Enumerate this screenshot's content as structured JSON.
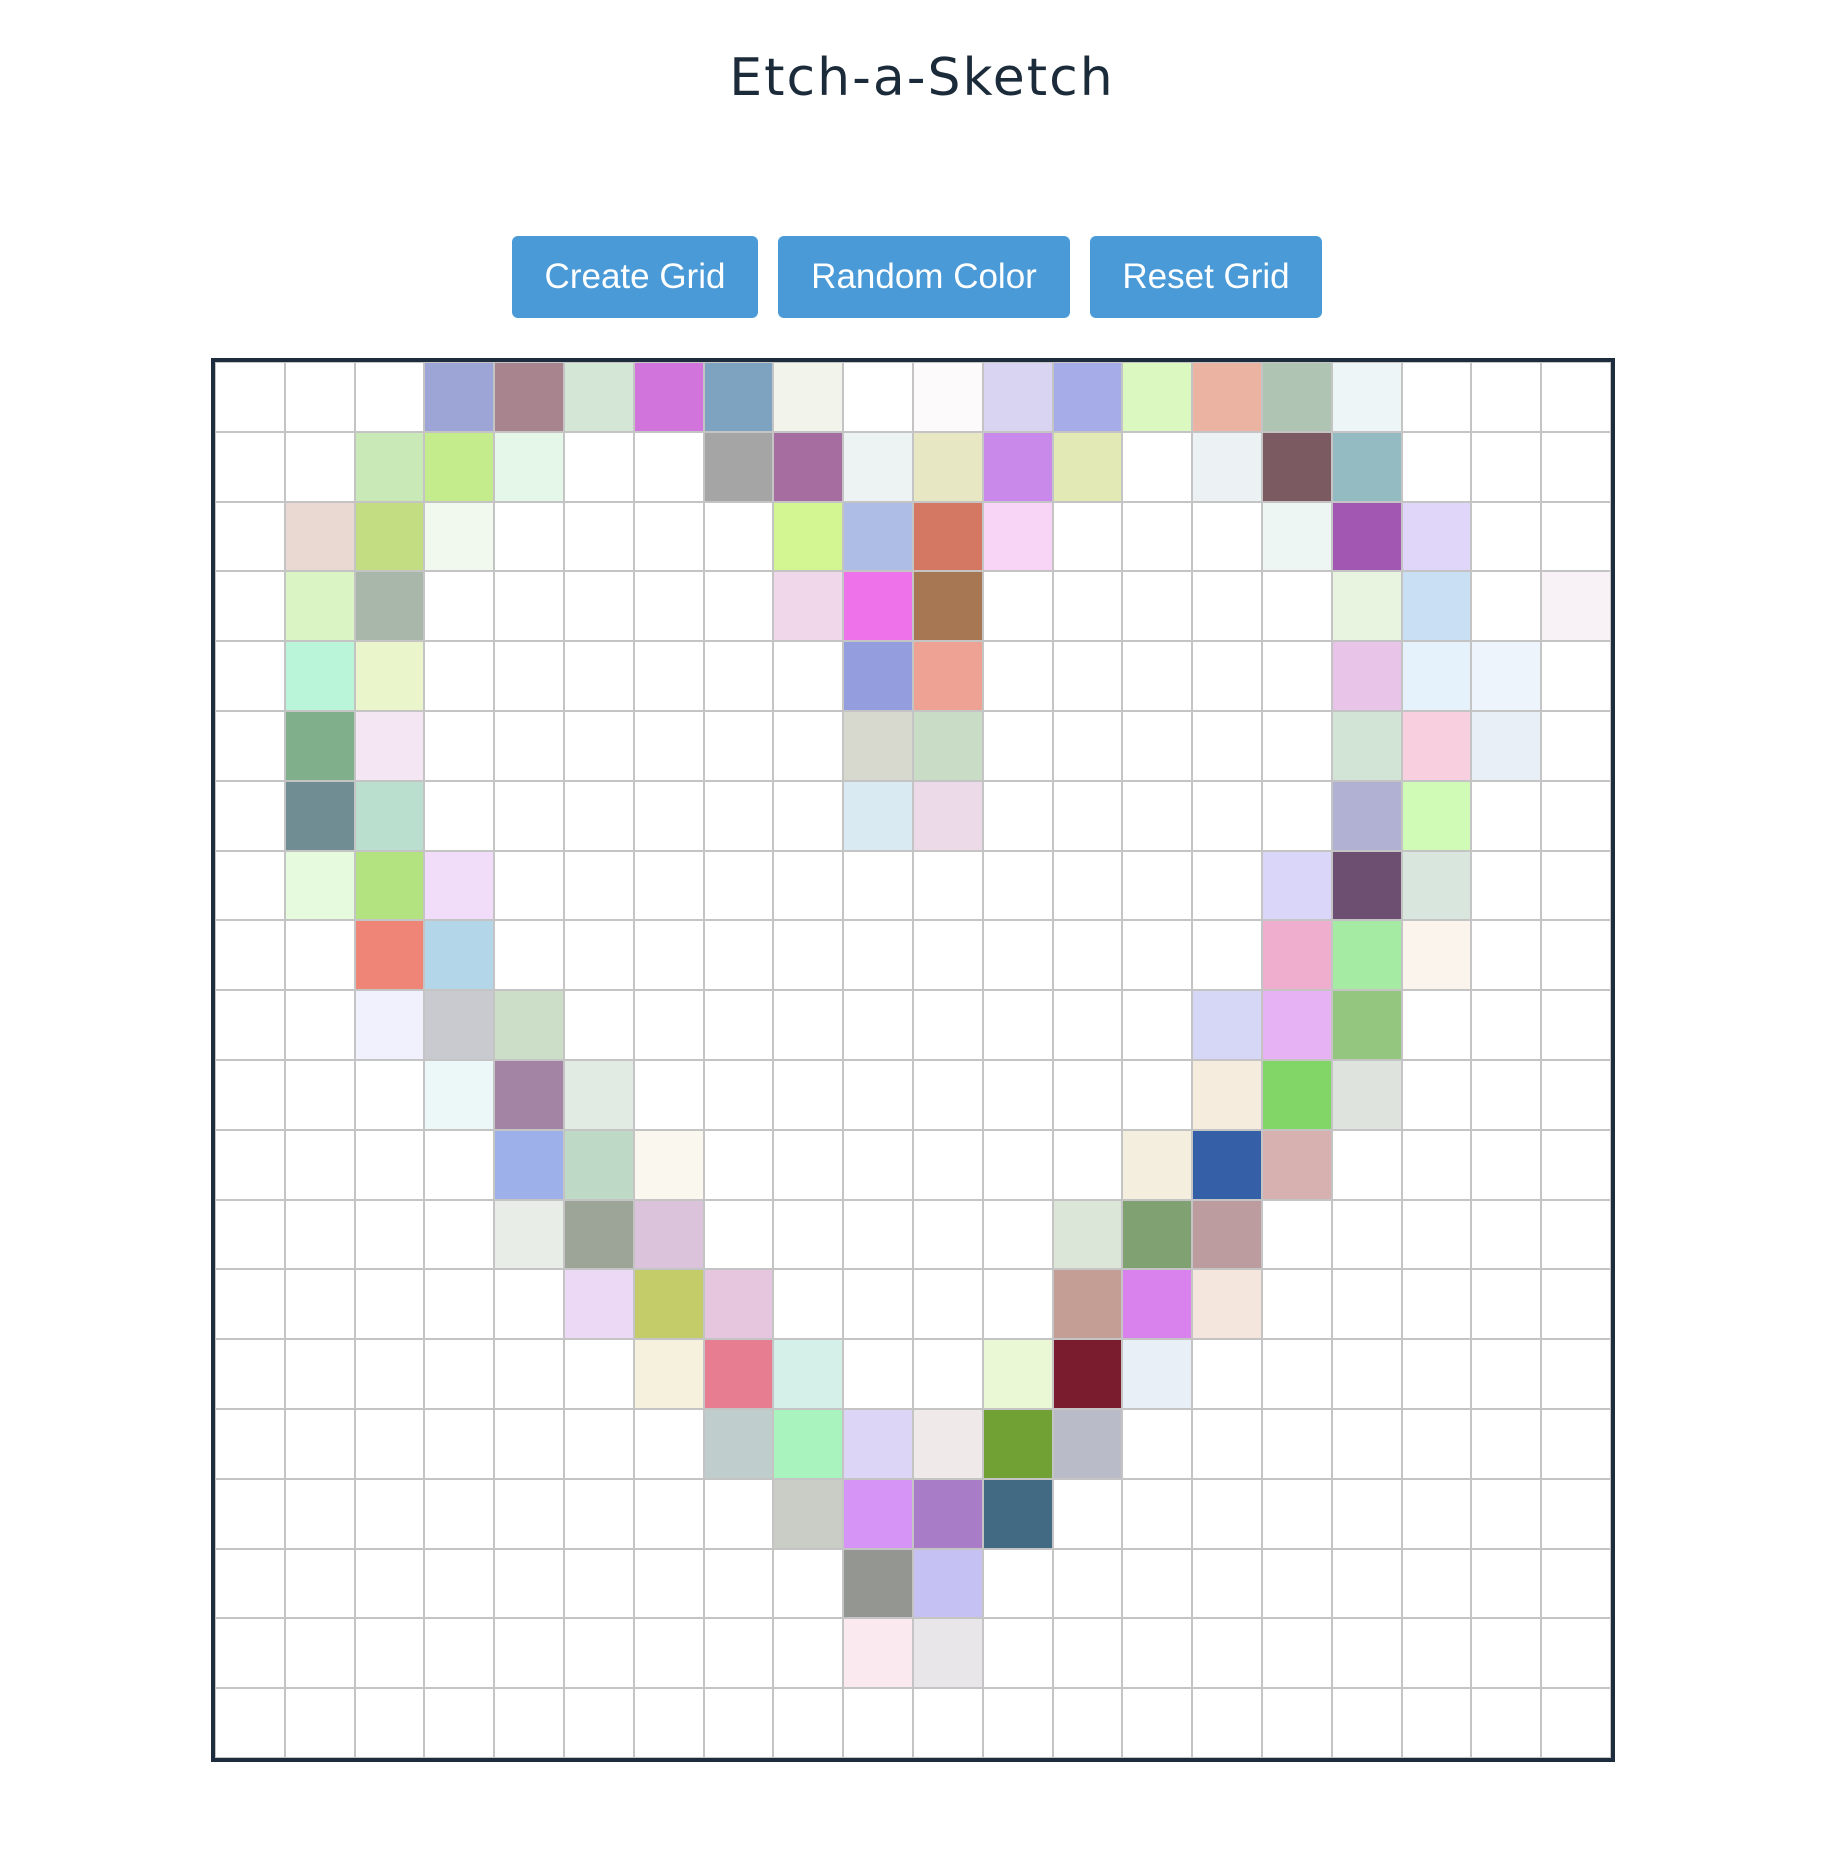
{
  "header": {
    "title": "Etch-a-Sketch"
  },
  "toolbar": {
    "create_label": "Create Grid",
    "random_label": "Random Color",
    "reset_label": "Reset Grid",
    "button_color": "#4a9ad8"
  },
  "grid": {
    "size": 20,
    "default_color": "#ffffff",
    "line_color": "#c4c4c4",
    "border_color": "#1e2d3e",
    "painted": [
      [
        0,
        3,
        "#9ca5d6"
      ],
      [
        0,
        4,
        "#a8858e"
      ],
      [
        0,
        5,
        "#d4e6d6"
      ],
      [
        0,
        6,
        "#d174db"
      ],
      [
        0,
        7,
        "#7ea3c0"
      ],
      [
        0,
        8,
        "#f2f3ea"
      ],
      [
        0,
        10,
        "#fcfafb"
      ],
      [
        0,
        11,
        "#d8d4f1"
      ],
      [
        0,
        12,
        "#a6ace8"
      ],
      [
        0,
        13,
        "#dbf8c0"
      ],
      [
        0,
        14,
        "#eab3a2"
      ],
      [
        0,
        15,
        "#b0c4b3"
      ],
      [
        0,
        16,
        "#eef5f6"
      ],
      [
        1,
        2,
        "#c9eab6"
      ],
      [
        1,
        3,
        "#c4ec8c"
      ],
      [
        1,
        4,
        "#e4f7e8"
      ],
      [
        1,
        7,
        "#a5a5a5"
      ],
      [
        1,
        8,
        "#a66da0"
      ],
      [
        1,
        9,
        "#edf3f2"
      ],
      [
        1,
        10,
        "#e7e7c4"
      ],
      [
        1,
        11,
        "#c889eb"
      ],
      [
        1,
        12,
        "#e3e9b4"
      ],
      [
        1,
        14,
        "#ecf1f3"
      ],
      [
        1,
        15,
        "#7b5a62"
      ],
      [
        1,
        16,
        "#95bbc2"
      ],
      [
        2,
        1,
        "#ead8d3"
      ],
      [
        2,
        2,
        "#c2dd82"
      ],
      [
        2,
        3,
        "#f1f9ee"
      ],
      [
        2,
        8,
        "#d3f592"
      ],
      [
        2,
        9,
        "#adbde6"
      ],
      [
        2,
        10,
        "#d47863"
      ],
      [
        2,
        11,
        "#f8d5f6"
      ],
      [
        2,
        15,
        "#eef6f4"
      ],
      [
        2,
        16,
        "#a257b3"
      ],
      [
        2,
        17,
        "#e0d6f9"
      ],
      [
        3,
        1,
        "#dbf4c4"
      ],
      [
        3,
        2,
        "#a8b7a9"
      ],
      [
        3,
        8,
        "#f1d7ea"
      ],
      [
        3,
        9,
        "#ee72e9"
      ],
      [
        3,
        10,
        "#a77653"
      ],
      [
        3,
        16,
        "#e8f4df"
      ],
      [
        3,
        17,
        "#c9dff3"
      ],
      [
        3,
        19,
        "#f8f1f5"
      ],
      [
        4,
        1,
        "#baf5d9"
      ],
      [
        4,
        2,
        "#ebf5cc"
      ],
      [
        4,
        9,
        "#949ddd"
      ],
      [
        4,
        10,
        "#eda294"
      ],
      [
        4,
        16,
        "#e8c5e8"
      ],
      [
        4,
        17,
        "#e5f2fb"
      ],
      [
        4,
        18,
        "#eef4fb"
      ],
      [
        5,
        1,
        "#7fb08b"
      ],
      [
        5,
        2,
        "#f5e6f3"
      ],
      [
        5,
        9,
        "#d7d9cf"
      ],
      [
        5,
        10,
        "#c9dcc6"
      ],
      [
        5,
        16,
        "#d1e4d6"
      ],
      [
        5,
        17,
        "#f7cfde"
      ],
      [
        5,
        18,
        "#e9eff6"
      ],
      [
        6,
        1,
        "#708d94"
      ],
      [
        6,
        2,
        "#bbdfcf"
      ],
      [
        6,
        9,
        "#daeaf2"
      ],
      [
        6,
        10,
        "#eddae9"
      ],
      [
        6,
        16,
        "#b0b1d3"
      ],
      [
        6,
        17,
        "#d0fbb7"
      ],
      [
        7,
        1,
        "#e6fadd"
      ],
      [
        7,
        2,
        "#b3e380"
      ],
      [
        7,
        3,
        "#f1dcf9"
      ],
      [
        7,
        15,
        "#d9d6f9"
      ],
      [
        7,
        16,
        "#6d4f72"
      ],
      [
        7,
        17,
        "#d9e6de"
      ],
      [
        8,
        2,
        "#ef8576"
      ],
      [
        8,
        3,
        "#b4d6e9"
      ],
      [
        8,
        15,
        "#f0aecf"
      ],
      [
        8,
        16,
        "#a6eba3"
      ],
      [
        8,
        17,
        "#fbf4ec"
      ],
      [
        9,
        2,
        "#f1f1fe"
      ],
      [
        9,
        3,
        "#c9cad0"
      ],
      [
        9,
        4,
        "#cddec8"
      ],
      [
        9,
        14,
        "#d6d6f6"
      ],
      [
        9,
        15,
        "#e7b2f4"
      ],
      [
        9,
        16,
        "#94c67f"
      ],
      [
        10,
        3,
        "#ecf8f8"
      ],
      [
        10,
        4,
        "#a384a4"
      ],
      [
        10,
        5,
        "#e1ebe4"
      ],
      [
        10,
        14,
        "#f6ecdd"
      ],
      [
        10,
        15,
        "#82d567"
      ],
      [
        10,
        16,
        "#dee4dd"
      ],
      [
        11,
        4,
        "#9db0ea"
      ],
      [
        11,
        5,
        "#bed9c5"
      ],
      [
        11,
        6,
        "#f9f7ee"
      ],
      [
        11,
        13,
        "#f4eede"
      ],
      [
        11,
        14,
        "#3560a8"
      ],
      [
        11,
        15,
        "#d7b1b0"
      ],
      [
        12,
        4,
        "#e8ede8"
      ],
      [
        12,
        5,
        "#9da498"
      ],
      [
        12,
        6,
        "#dcc3dc"
      ],
      [
        12,
        12,
        "#dbe5d8"
      ],
      [
        12,
        13,
        "#80a273"
      ],
      [
        12,
        14,
        "#bc9c9e"
      ],
      [
        13,
        5,
        "#ecd9f6"
      ],
      [
        13,
        6,
        "#c4cb69"
      ],
      [
        13,
        7,
        "#e5c6de"
      ],
      [
        13,
        12,
        "#c49e95"
      ],
      [
        13,
        13,
        "#d982ee"
      ],
      [
        13,
        14,
        "#f4e6dc"
      ],
      [
        14,
        6,
        "#f6f1dc"
      ],
      [
        14,
        7,
        "#e77d91"
      ],
      [
        14,
        8,
        "#d4f0e8"
      ],
      [
        14,
        11,
        "#ebf8d6"
      ],
      [
        14,
        12,
        "#7b1b2e"
      ],
      [
        14,
        13,
        "#e9eff6"
      ],
      [
        15,
        7,
        "#c0cdcd"
      ],
      [
        15,
        8,
        "#a9f4be"
      ],
      [
        15,
        9,
        "#ddd5f5"
      ],
      [
        15,
        10,
        "#efe9ea"
      ],
      [
        15,
        11,
        "#71a034"
      ],
      [
        15,
        12,
        "#b9bbc8"
      ],
      [
        16,
        8,
        "#c9cdc5"
      ],
      [
        16,
        9,
        "#d694f7"
      ],
      [
        16,
        10,
        "#a87cc6"
      ],
      [
        16,
        11,
        "#426b83"
      ],
      [
        17,
        9,
        "#949691"
      ],
      [
        17,
        10,
        "#c5c1f3"
      ],
      [
        18,
        9,
        "#faeaf0"
      ],
      [
        18,
        10,
        "#e8e6e9"
      ]
    ]
  }
}
